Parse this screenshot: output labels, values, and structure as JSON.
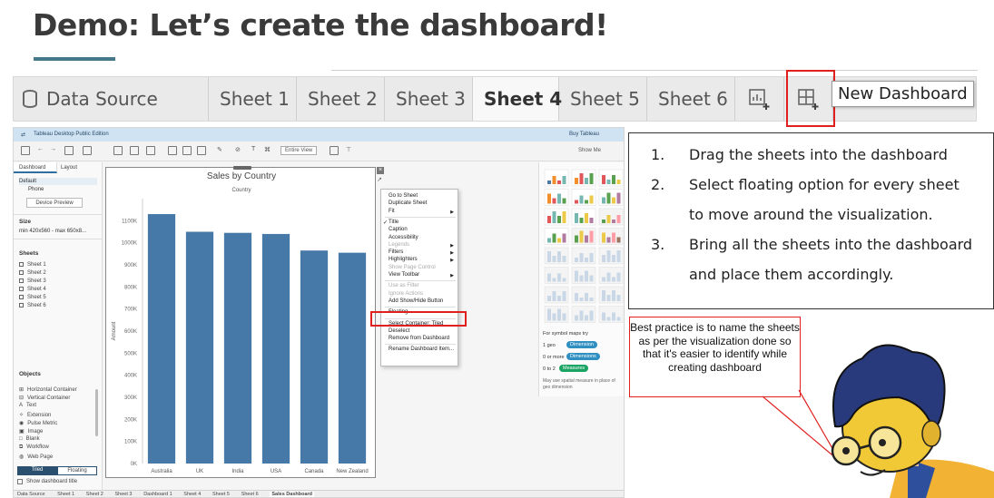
{
  "slide": {
    "title": "Demo: Let’s create the dashboard!"
  },
  "tabbar": {
    "tabs": [
      {
        "label": "Data Source",
        "icon": "database-icon"
      },
      {
        "label": "Sheet 1"
      },
      {
        "label": "Sheet 2"
      },
      {
        "label": "Sheet 3"
      },
      {
        "label": "Sheet 4",
        "active": true
      },
      {
        "label": "Sheet 5"
      },
      {
        "label": "Sheet 6"
      }
    ],
    "new_worksheet_icon": "new-worksheet-icon",
    "new_dashboard_icon": "new-dashboard-icon",
    "tooltip": "New Dashboard",
    "highlight_color": "#e0201e"
  },
  "tableau": {
    "app_title": "Tableau Desktop Public Edition",
    "buy_link": "Buy Tableau",
    "entire_view": "Entire View",
    "show_me": "Show Me",
    "left_panel": {
      "tabs": [
        "Dashboard",
        "Layout"
      ],
      "device_default": "Default",
      "device_phone": "Phone",
      "device_preview": "Device Preview",
      "size_heading": "Size",
      "size_value": "min 420x560 - max 650x8...",
      "sheets_heading": "Sheets",
      "sheets": [
        "Sheet 1",
        "Sheet 2",
        "Sheet 3",
        "Sheet 4",
        "Sheet 5",
        "Sheet 6"
      ],
      "objects_heading": "Objects",
      "objects": [
        "Horizontal Container",
        "Vertical Container",
        "Text",
        "Extension",
        "Pulse Metric",
        "Image",
        "Blank",
        "Workflow",
        "Web Page"
      ],
      "tiled": "Tiled",
      "floating": "Floating",
      "show_title": "Show dashboard title"
    },
    "context_menu": {
      "items": [
        {
          "label": "Go to Sheet"
        },
        {
          "label": "Duplicate Sheet"
        },
        {
          "label": "Fit",
          "submenu": true
        },
        {
          "label": "Title",
          "checked": true
        },
        {
          "label": "Caption"
        },
        {
          "label": "Accessibility"
        },
        {
          "label": "Legends",
          "submenu": true,
          "disabled": true
        },
        {
          "label": "Filters",
          "submenu": true
        },
        {
          "label": "Highlighters",
          "submenu": true
        },
        {
          "label": "Show Page Control",
          "disabled": true
        },
        {
          "label": "View Toolbar",
          "submenu": true
        },
        {
          "label": "Use as Filter",
          "disabled": true
        },
        {
          "label": "Ignore Actions",
          "disabled": true
        },
        {
          "label": "Add Show/Hide Button"
        },
        {
          "label": "Floating"
        },
        {
          "label": "Select Container: Tiled"
        },
        {
          "label": "Deselect"
        },
        {
          "label": "Remove from Dashboard"
        },
        {
          "label": "Rename Dashboard Item..."
        }
      ]
    },
    "show_me_panel": {
      "maps_label": "For symbol maps try",
      "row1_left": "1 geo",
      "row1_pill": "Dimension",
      "row2_left": "0 or more",
      "row2_pill": "Dimensions",
      "row3_left": "0 to 2",
      "row3_pill": "Measures",
      "hint": "May use spatial measure in place of geo dimension",
      "pill_color": "#2f8fc0",
      "measure_color": "#19a463"
    },
    "bottom_tabs": [
      "Data Source",
      "Sheet 1",
      "Sheet 2",
      "Sheet 3",
      "Dashboard 1",
      "Sheet 4",
      "Sheet 5",
      "Sheet 6",
      "Sales Dashboard"
    ]
  },
  "chart_data": {
    "type": "bar",
    "title": "Sales by Country",
    "column_header": "Country",
    "ylabel": "Amount",
    "categories": [
      "Australia",
      "UK",
      "India",
      "USA",
      "Canada",
      "New Zealand"
    ],
    "values": [
      1130,
      1050,
      1045,
      1040,
      965,
      955
    ],
    "y_ticks": [
      "0K",
      "100K",
      "200K",
      "300K",
      "400K",
      "500K",
      "600K",
      "700K",
      "800K",
      "900K",
      "1000K",
      "1100K"
    ],
    "ylim": [
      0,
      1200
    ],
    "bar_color": "#4678a8"
  },
  "instructions": [
    {
      "num": "1.",
      "text": "Drag the sheets into the dashboard"
    },
    {
      "num": "2.",
      "text": "Select floating option for every sheet",
      "text2": "to move around the visualization."
    },
    {
      "num": "3.",
      "text": "Bring all the sheets into the dashboard",
      "text2": "and place them accordingly."
    }
  ],
  "callout": {
    "text": "Best practice is to name the sheets as per the visualization done so that it's easier to identify while creating dashboard"
  }
}
